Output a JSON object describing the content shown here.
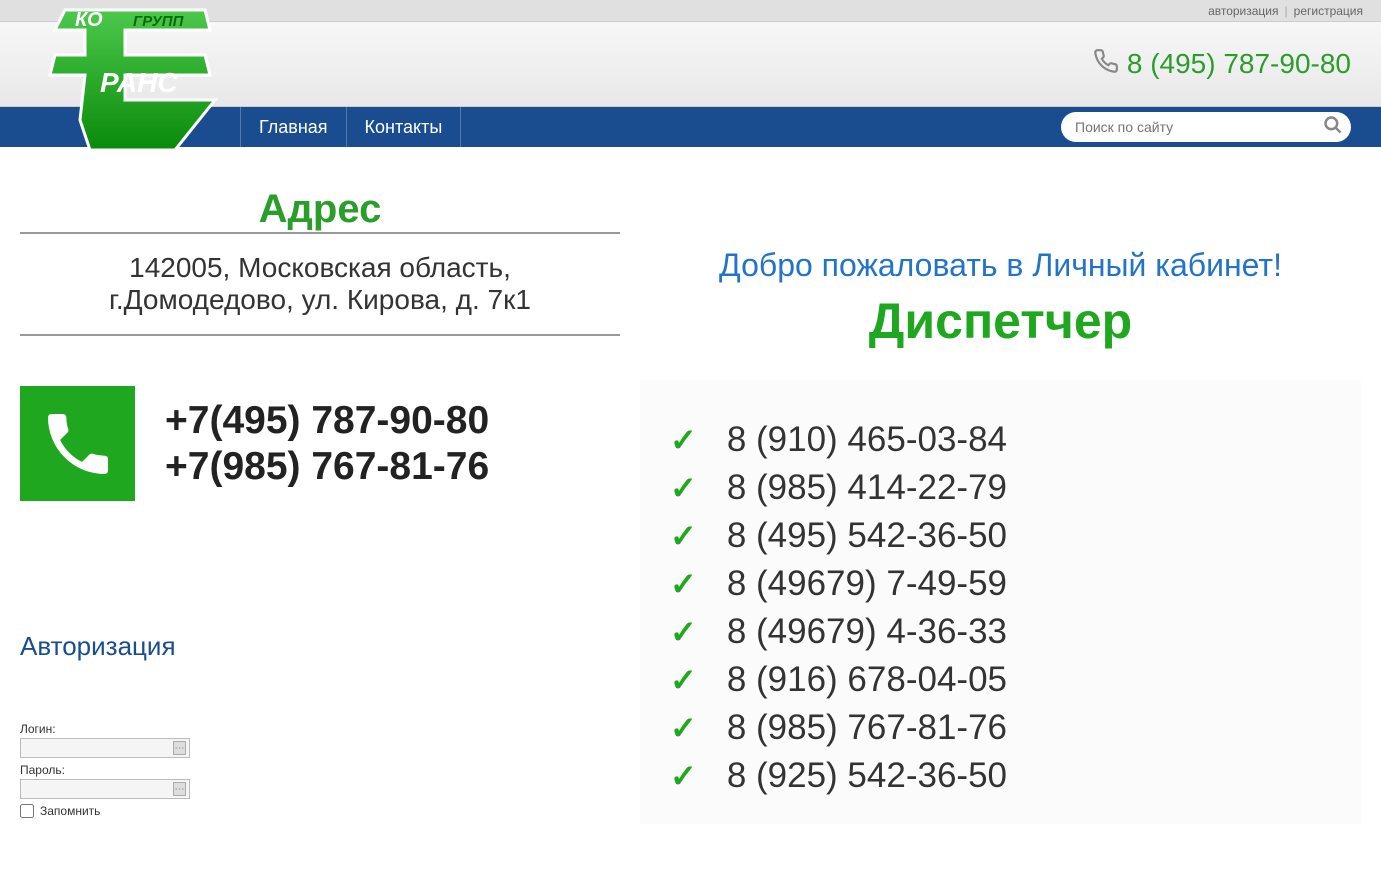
{
  "topbar": {
    "auth": "авторизация",
    "register": "регистрация"
  },
  "header": {
    "phone": "8 (495) 787-90-80"
  },
  "nav": {
    "home": "Главная",
    "contacts": "Контакты"
  },
  "search": {
    "placeholder": "Поиск по сайту"
  },
  "address": {
    "title": "Адрес",
    "line1": "142005, Московская область,",
    "line2": "г.Домодедово, ул. Кирова, д. 7к1"
  },
  "phones_main": {
    "p1": "+7(495) 787-90-80",
    "p2": "+7(985) 767-81-76"
  },
  "auth": {
    "title": "Авторизация",
    "login_label": "Логин:",
    "password_label": "Пароль:",
    "remember": "Запомнить"
  },
  "panel": {
    "welcome": "Добро пожаловать в Личный кабинет!",
    "dispatcher": "Диспетчер",
    "phones": [
      "8 (910) 465-03-84",
      "8 (985) 414-22-79",
      "8 (495) 542-36-50",
      "8 (49679) 7-49-59",
      "8 (49679) 4-36-33",
      "8 (916) 678-04-05",
      "8 (985) 767-81-76",
      "8 (925) 542-36-50"
    ]
  }
}
